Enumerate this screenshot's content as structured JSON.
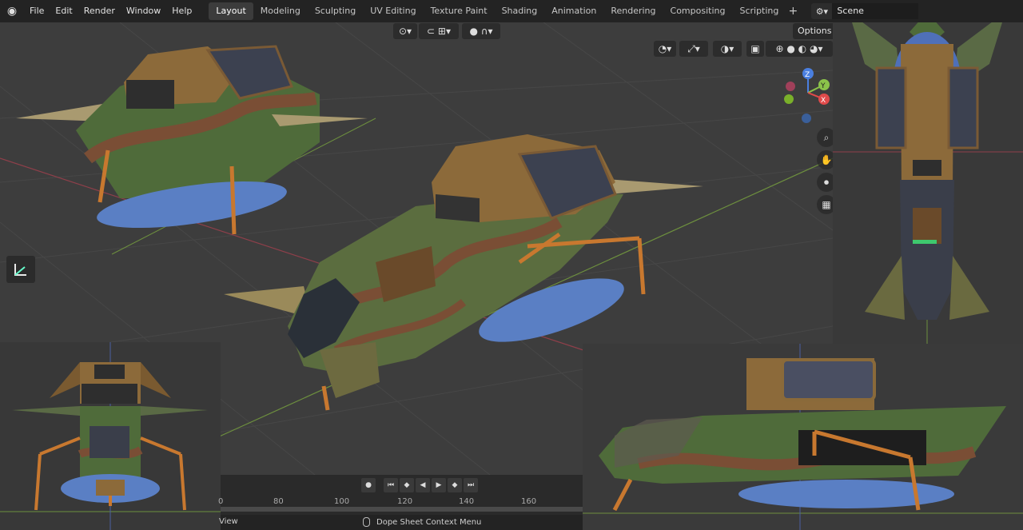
{
  "topbar": {
    "menus": [
      "File",
      "Edit",
      "Render",
      "Window",
      "Help"
    ],
    "workspaces": [
      "Layout",
      "Modeling",
      "Sculpting",
      "UV Editing",
      "Texture Paint",
      "Shading",
      "Animation",
      "Rendering",
      "Compositing",
      "Scripting"
    ],
    "active_workspace": "Layout",
    "scene_name": "Scene"
  },
  "viewport": {
    "options_label": "Options",
    "gizmo_axes": {
      "z": "Z",
      "y": "Y",
      "x": "X"
    }
  },
  "timeline": {
    "ticks": [
      "0",
      "80",
      "100",
      "120",
      "140",
      "160"
    ],
    "view_label": "View",
    "status_text": "Dope Sheet Context Menu"
  },
  "colors": {
    "camo_green": "#4f6b3a",
    "camo_brown": "#7a4e35",
    "float_blue": "#5a7fc4",
    "strut_orange": "#c8782f",
    "body_tan": "#8c6a3a"
  }
}
